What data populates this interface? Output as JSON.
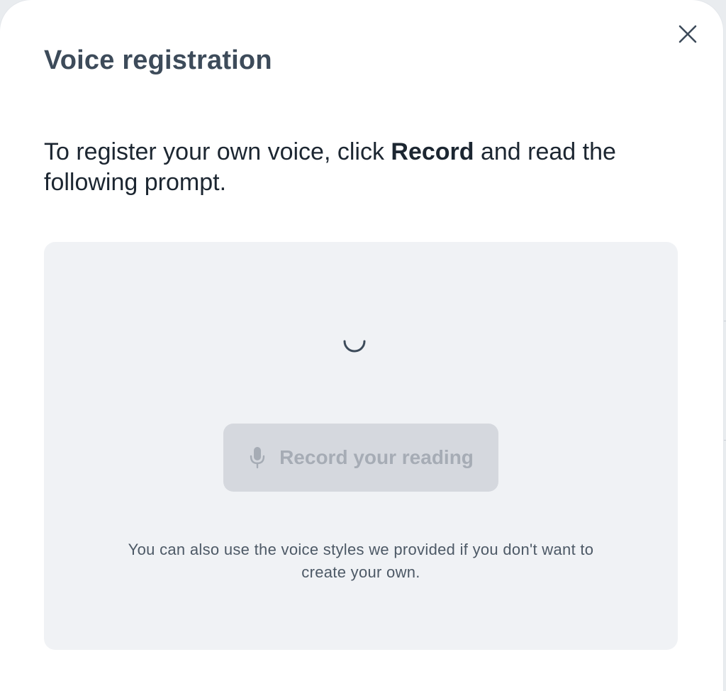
{
  "dialog": {
    "title": "Voice registration",
    "close_icon": "close-icon",
    "instruction": {
      "prefix": "To register your own voice, click ",
      "bold": "Record",
      "suffix": " and read the following prompt."
    },
    "panel": {
      "loading_icon": "spinner-icon",
      "record_button": {
        "icon": "microphone-icon",
        "label": "Record your reading",
        "state": "disabled"
      },
      "note": "You can also use the voice styles we provided if you don't want to create your own."
    }
  },
  "colors": {
    "title": "#3d4b5a",
    "panel_background": "#f0f2f5",
    "disabled_button": "#d5d8de",
    "disabled_text": "#a6acb5"
  }
}
